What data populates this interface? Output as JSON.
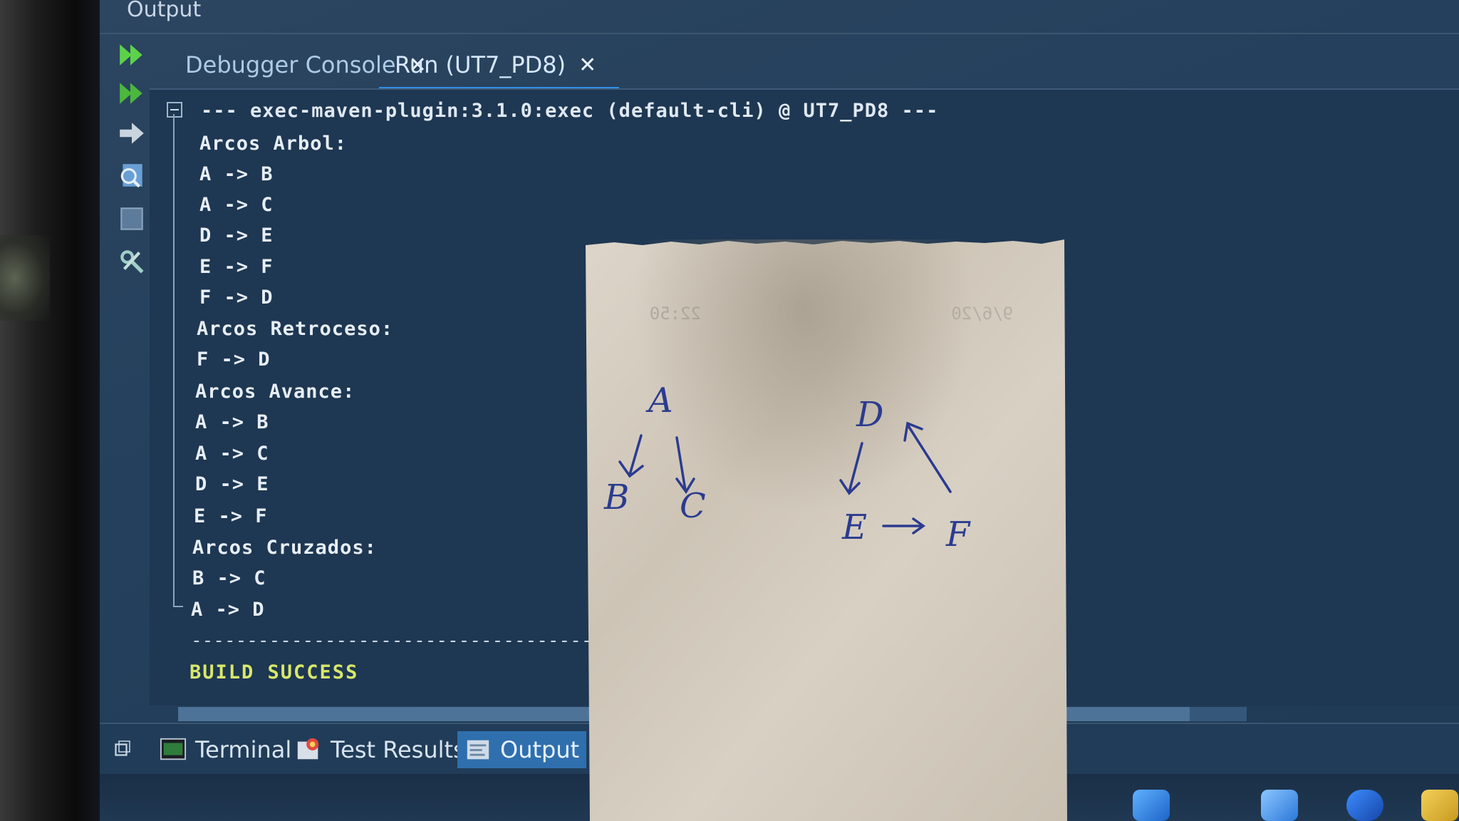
{
  "panel": {
    "title": "Output"
  },
  "tabs": [
    {
      "label": "Debugger Console",
      "close": "✕"
    },
    {
      "label": "Run (UT7_PD8)",
      "close": "✕"
    }
  ],
  "console": {
    "header_line": "--- exec-maven-plugin:3.1.0:exec (default-cli) @ UT7_PD8 ---",
    "lines": [
      "Arcos Arbol:",
      "A -> B",
      "A -> C",
      "D -> E",
      "E -> F",
      "F -> D",
      "Arcos Retroceso:",
      "F -> D",
      "Arcos Avance:",
      "A -> B",
      "A -> C",
      "D -> E",
      "E -> F",
      "Arcos Cruzados:",
      "B -> C",
      "A -> D"
    ],
    "separator": "------------------------------------------------------------------------",
    "status": "BUILD SUCCESS"
  },
  "bottom_tabs": [
    {
      "label": "Terminal",
      "icon": "terminal-icon"
    },
    {
      "label": "Test Results",
      "icon": "test-results-icon"
    },
    {
      "label": "Output",
      "icon": "output-icon"
    }
  ],
  "note": {
    "printed_time": "22:50",
    "printed_date": "9/6/20",
    "handwritten_nodes": [
      "A",
      "B",
      "C",
      "D",
      "E",
      "F"
    ]
  },
  "colors": {
    "console_bg": "#1e3752",
    "active_tab_underline": "#2f8fe6",
    "success_text": "#d8e86a",
    "paper": "#d9d2c6",
    "ink": "#2a3a8a"
  }
}
